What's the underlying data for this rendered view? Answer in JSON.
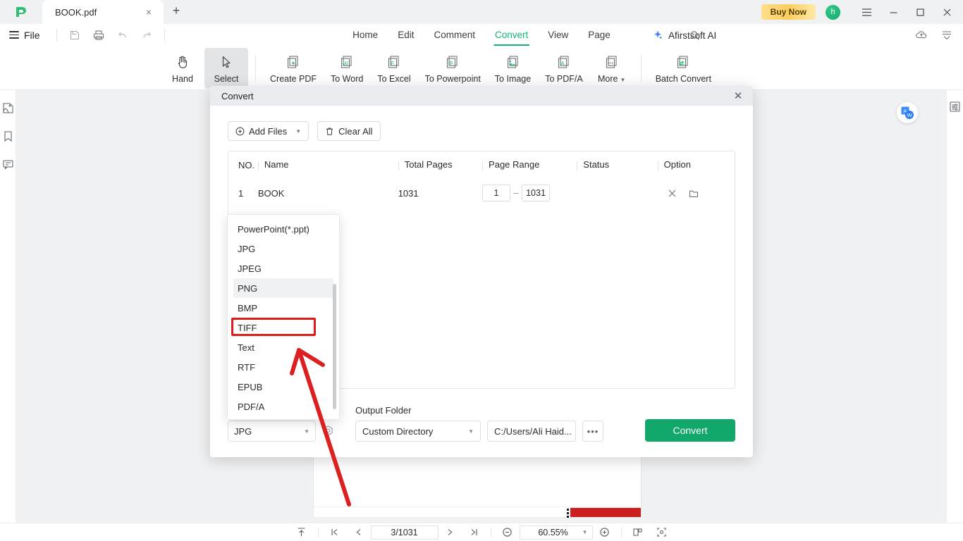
{
  "titlebar": {
    "tab_label": "BOOK.pdf",
    "close_tab": "×",
    "new_tab": "+",
    "buy_now": "Buy Now",
    "avatar_initial": "h",
    "menu_icon": "hamburger-menu",
    "minimize": "—",
    "maximize": "□",
    "close": "✕"
  },
  "menubar": {
    "file_label": "File",
    "quick_icons": [
      "save-icon",
      "print-icon",
      "undo-icon",
      "redo-icon"
    ],
    "tabs": [
      {
        "label": "Home",
        "active": false
      },
      {
        "label": "Edit",
        "active": false
      },
      {
        "label": "Comment",
        "active": false
      },
      {
        "label": "Convert",
        "active": true
      },
      {
        "label": "View",
        "active": false
      },
      {
        "label": "Page",
        "active": false
      }
    ],
    "ai_label": "Afirstsoft AI",
    "right_icons": [
      "cloud-upload-icon",
      "collapse-ribbon-icon"
    ]
  },
  "ribbon": {
    "items": [
      {
        "label": "Hand",
        "icon": "hand-icon",
        "selected": false
      },
      {
        "label": "Select",
        "icon": "cursor-arrow-icon",
        "selected": true
      },
      {
        "label": "Create PDF",
        "icon": "create-pdf-icon",
        "selected": false
      },
      {
        "label": "To Word",
        "icon": "to-word-icon",
        "selected": false
      },
      {
        "label": "To Excel",
        "icon": "to-excel-icon",
        "selected": false
      },
      {
        "label": "To Powerpoint",
        "icon": "to-powerpoint-icon",
        "selected": false
      },
      {
        "label": "To Image",
        "icon": "to-image-icon",
        "selected": false
      },
      {
        "label": "To PDF/A",
        "icon": "to-pdfa-icon",
        "selected": false
      },
      {
        "label": "More",
        "icon": "more-icon",
        "selected": false,
        "has_caret": true
      },
      {
        "label": "Batch Convert",
        "icon": "batch-convert-icon",
        "selected": false
      }
    ]
  },
  "left_rail": {
    "icons": [
      "thumbnail-icon",
      "bookmark-icon",
      "comment-icon"
    ]
  },
  "right_rail": {
    "icons": [
      "properties-panel-icon"
    ]
  },
  "workarea": {
    "word_badge": "translate-to-word-badge"
  },
  "dialog": {
    "title": "Convert",
    "close_label": "✕",
    "add_files_label": "Add Files",
    "clear_all_label": "Clear All",
    "table": {
      "headers": [
        "NO.",
        "Name",
        "Total Pages",
        "Page Range",
        "Status",
        "Option"
      ],
      "rows": [
        {
          "no": "1",
          "name": "BOOK",
          "total_pages": "1031",
          "page_from": "1",
          "page_to": "1031",
          "range_dash": "–",
          "status": "",
          "options": [
            "remove-file-icon",
            "open-folder-icon"
          ]
        }
      ]
    },
    "format_value": "JPG",
    "settings_icon": "output-settings-icon",
    "output_folder_label": "Output Folder",
    "directory_value": "Custom Directory",
    "path_value": "C:/Users/Ali Haid...",
    "browse_label": "•••",
    "convert_label": "Convert"
  },
  "format_dropdown": {
    "options": [
      {
        "label": "PowerPoint(*.ppt)",
        "hover": false,
        "highlighted": false
      },
      {
        "label": "JPG",
        "hover": false,
        "highlighted": false
      },
      {
        "label": "JPEG",
        "hover": false,
        "highlighted": false
      },
      {
        "label": "PNG",
        "hover": true,
        "highlighted": false
      },
      {
        "label": "BMP",
        "hover": false,
        "highlighted": false
      },
      {
        "label": "TIFF",
        "hover": false,
        "highlighted": true
      },
      {
        "label": "Text",
        "hover": false,
        "highlighted": false
      },
      {
        "label": "RTF",
        "hover": false,
        "highlighted": false
      },
      {
        "label": "EPUB",
        "hover": false,
        "highlighted": false
      },
      {
        "label": "PDF/A",
        "hover": false,
        "highlighted": false
      }
    ],
    "highlight_color": "#e01b1b"
  },
  "annotation": {
    "arrow_color": "#dc1f1f",
    "arrow_name": "red-pointer-arrow"
  },
  "statusbar": {
    "fit_top_icon": "scroll-to-top-icon",
    "first_page_icon": "first-page-icon",
    "prev_page_icon": "previous-page-icon",
    "page_value": "3/1031",
    "next_page_icon": "next-page-icon",
    "last_page_icon": "last-page-icon",
    "zoom_out_icon": "zoom-out-icon",
    "zoom_value": "60.55%",
    "zoom_in_icon": "zoom-in-icon",
    "fit_page_icon": "fit-page-icon",
    "fit_width_icon": "fit-width-icon"
  },
  "colors": {
    "accent_green": "#12b171",
    "convert_green": "#12a86b",
    "annotation_red": "#dc1f1f",
    "buy_now_gold": "#f9cd5f",
    "workspace_gray": "#f0f1f3"
  }
}
